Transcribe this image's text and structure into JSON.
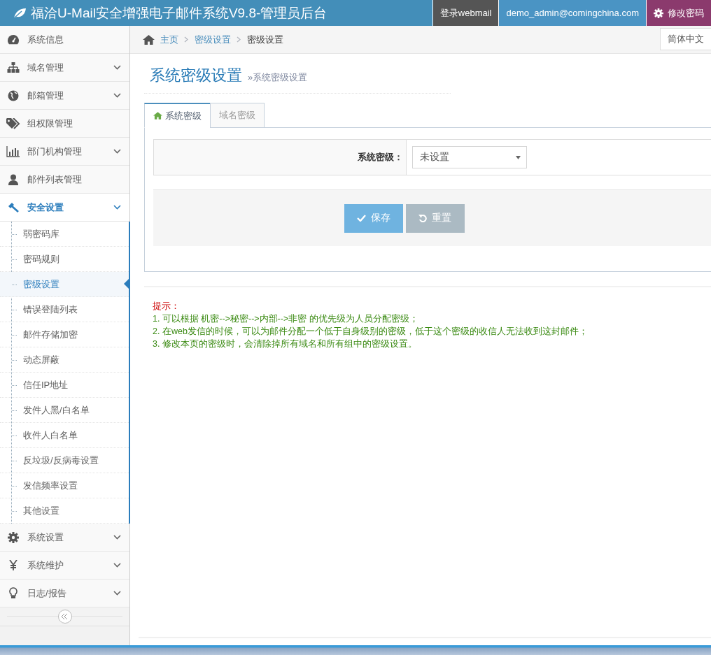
{
  "header": {
    "title": "福洽U-Mail安全增强电子邮件系统V9.8-管理员后台",
    "links": [
      {
        "label": "登录webmail",
        "kind": "dark"
      },
      {
        "label": "demo_admin@comingchina.com",
        "kind": "blue"
      },
      {
        "label": "修改密码",
        "kind": "purple"
      }
    ]
  },
  "sidebar": {
    "items": [
      {
        "label": "系统信息",
        "expandable": false,
        "expanded": false
      },
      {
        "label": "域名管理",
        "expandable": true,
        "expanded": false
      },
      {
        "label": "邮箱管理",
        "expandable": true,
        "expanded": false
      },
      {
        "label": "组权限管理",
        "expandable": false,
        "expanded": false
      },
      {
        "label": "部门机构管理",
        "expandable": true,
        "expanded": false
      },
      {
        "label": "邮件列表管理",
        "expandable": false,
        "expanded": false
      },
      {
        "label": "安全设置",
        "expandable": true,
        "expanded": true,
        "children": [
          {
            "label": "弱密码库",
            "selected": false
          },
          {
            "label": "密码规则",
            "selected": false
          },
          {
            "label": "密级设置",
            "selected": true
          },
          {
            "label": "错误登陆列表",
            "selected": false
          },
          {
            "label": "邮件存储加密",
            "selected": false
          },
          {
            "label": "动态屏蔽",
            "selected": false
          },
          {
            "label": "信任IP地址",
            "selected": false
          },
          {
            "label": "发件人黑/白名单",
            "selected": false
          },
          {
            "label": "收件人白名单",
            "selected": false
          },
          {
            "label": "反垃圾/反病毒设置",
            "selected": false
          },
          {
            "label": "发信频率设置",
            "selected": false
          },
          {
            "label": "其他设置",
            "selected": false
          }
        ]
      },
      {
        "label": "系统设置",
        "expandable": true,
        "expanded": false
      },
      {
        "label": "系统维护",
        "expandable": true,
        "expanded": false
      },
      {
        "label": "日志/报告",
        "expandable": true,
        "expanded": false
      }
    ]
  },
  "breadcrumb": {
    "items": [
      "主页",
      "密级设置",
      "密级设置"
    ],
    "language": "简体中文"
  },
  "page": {
    "title": "系统密级设置",
    "subtitle": "»系统密级设置",
    "tabs": [
      {
        "label": "系统密级",
        "selected": true
      },
      {
        "label": "域名密级",
        "selected": false
      }
    ],
    "form": {
      "label": "系统密级：",
      "value": "未设置"
    },
    "buttons": [
      {
        "label": "保存",
        "kind": "primary"
      },
      {
        "label": "重置",
        "kind": "secondary"
      }
    ],
    "tips": {
      "heading": "提示：",
      "lines": [
        "1. 可以根据 机密-->秘密-->内部-->非密 的优先级为人员分配密级；",
        "2. 在web发信的时候，可以为邮件分配一个低于自身级别的密级，低于这个密级的收信人无法收到这封邮件；",
        "3.  修改本页的密级时，会清除掉所有域名和所有组中的密级设置。"
      ]
    }
  }
}
